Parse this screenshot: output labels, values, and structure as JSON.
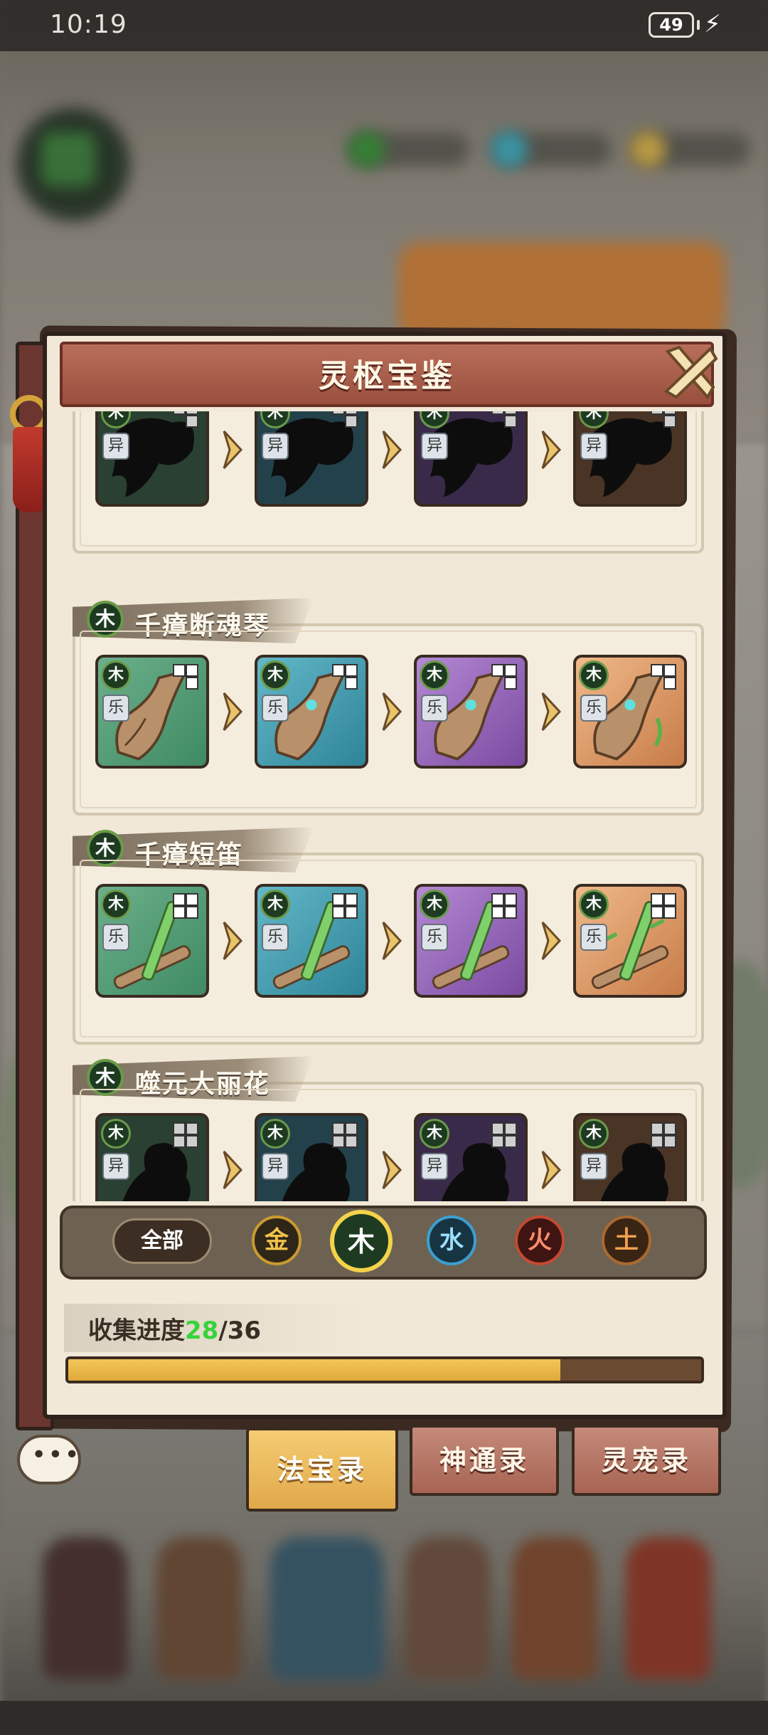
{
  "status_bar": {
    "time": "10:19",
    "battery": "49"
  },
  "panel": {
    "title": "灵枢宝鉴"
  },
  "items": [
    {
      "name": "",
      "element": "木",
      "category": "异",
      "locked": true,
      "tiles": [
        {
          "tier": "green",
          "element": "木",
          "category": "异"
        },
        {
          "tier": "teal",
          "element": "木",
          "category": "异"
        },
        {
          "tier": "purple",
          "element": "木",
          "category": "异"
        },
        {
          "tier": "orange",
          "element": "木",
          "category": "异"
        }
      ]
    },
    {
      "name": "千瘴断魂琴",
      "element": "木",
      "category": "乐",
      "locked": false,
      "tiles": [
        {
          "tier": "green",
          "element": "木",
          "category": "乐"
        },
        {
          "tier": "teal",
          "element": "木",
          "category": "乐"
        },
        {
          "tier": "purple",
          "element": "木",
          "category": "乐"
        },
        {
          "tier": "orange",
          "element": "木",
          "category": "乐"
        }
      ]
    },
    {
      "name": "千瘴短笛",
      "element": "木",
      "category": "乐",
      "locked": false,
      "tiles": [
        {
          "tier": "green",
          "element": "木",
          "category": "乐"
        },
        {
          "tier": "teal",
          "element": "木",
          "category": "乐"
        },
        {
          "tier": "purple",
          "element": "木",
          "category": "乐"
        },
        {
          "tier": "orange",
          "element": "木",
          "category": "乐"
        }
      ]
    },
    {
      "name": "噬元大丽花",
      "element": "木",
      "category": "异",
      "locked": true,
      "tiles": [
        {
          "tier": "green",
          "element": "木",
          "category": "异"
        },
        {
          "tier": "teal",
          "element": "木",
          "category": "异"
        },
        {
          "tier": "purple",
          "element": "木",
          "category": "异"
        },
        {
          "tier": "orange",
          "element": "木",
          "category": "异"
        }
      ]
    }
  ],
  "filters": {
    "all": "全部",
    "gold": "金",
    "wood": "木",
    "water": "水",
    "fire": "火",
    "earth": "土",
    "selected": "木"
  },
  "progress": {
    "label": "收集进度",
    "current": "28",
    "separator": "/",
    "total": "36",
    "fraction": 0.778
  },
  "tabs": [
    {
      "label": "法宝录",
      "active": true
    },
    {
      "label": "神通录",
      "active": false
    },
    {
      "label": "灵宠录",
      "active": false
    }
  ],
  "icons": {
    "close": "close-icon",
    "chat": "chat-bubble-icon",
    "charging": "charging-icon",
    "upgrade_arrow": "chevron-right-icon",
    "slot_grid": "grid-shape-icon"
  },
  "colors": {
    "progress_fill": "#f3c65a",
    "progress_current": "#37d23a",
    "tab_active": "#f5cd72",
    "tab_inactive": "#b57565",
    "header": "#a85a46"
  }
}
